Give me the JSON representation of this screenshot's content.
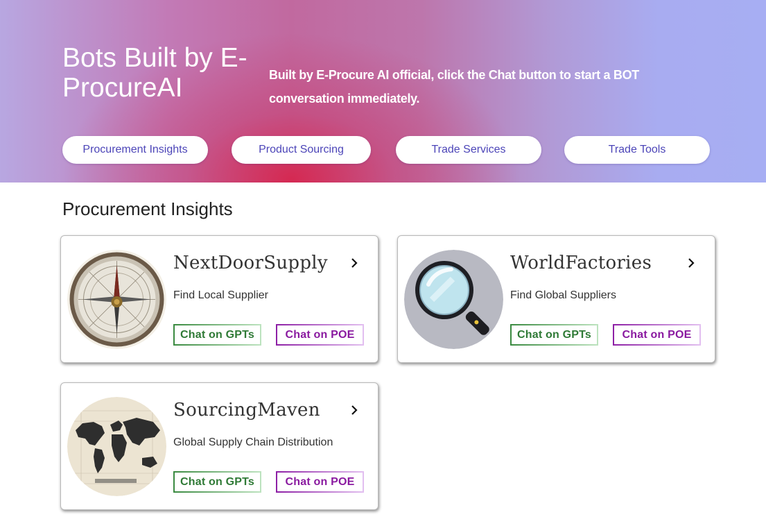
{
  "hero": {
    "title": "Bots Built by E-ProcureAI",
    "description": "Built by E-Procure AI official, click the Chat button to start a BOT conversation immediately."
  },
  "categories": [
    {
      "label": "Procurement Insights"
    },
    {
      "label": "Product Sourcing"
    },
    {
      "label": "Trade Services"
    },
    {
      "label": "Trade Tools"
    }
  ],
  "section": {
    "title": "Procurement Insights"
  },
  "bots": [
    {
      "name": "NextDoorSupply",
      "description": "Find Local Supplier",
      "gpt_label": "Chat on GPTs",
      "poe_label": "Chat on POE",
      "icon": "compass-icon"
    },
    {
      "name": "WorldFactories",
      "description": "Find Global Suppliers",
      "gpt_label": "Chat on GPTs",
      "poe_label": "Chat on POE",
      "icon": "magnifier-icon"
    },
    {
      "name": "SourcingMaven",
      "description": "Global Supply Chain Distribution",
      "gpt_label": "Chat on GPTs",
      "poe_label": "Chat on POE",
      "icon": "world-map-icon"
    }
  ],
  "colors": {
    "accent_text": "#4c45b8",
    "gpt_green": "#2f7a36",
    "poe_purple": "#8a1aa0"
  }
}
